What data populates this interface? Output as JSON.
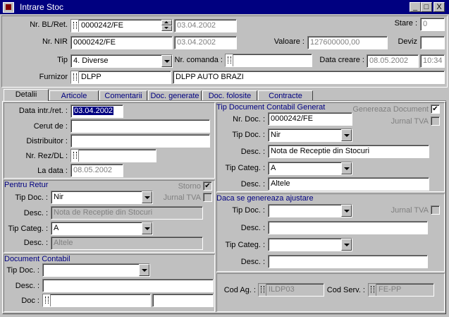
{
  "window": {
    "title": "Intrare Stoc",
    "buttons": {
      "minimize": "_",
      "maximize": "□",
      "close": "X"
    }
  },
  "header": {
    "nr_bl_label": "Nr. BL/Ret.",
    "nr_bl_value": "0000242/FE",
    "nr_bl_date": "03.04.2002",
    "nr_nir_label": "Nr. NIR",
    "nr_nir_value": "0000242/FE",
    "nr_nir_date": "03.04.2002",
    "tip_label": "Tip",
    "tip_value": "4. Diverse",
    "nr_comanda_label": "Nr. comanda :",
    "nr_comanda_value": "",
    "furnizor_label": "Furnizor",
    "furnizor_code": "DLPP",
    "furnizor_name": "DLPP AUTO BRAZI",
    "stare_label": "Stare :",
    "stare_value": "0",
    "valoare_label": "Valoare :",
    "valoare_value": "127600000,00",
    "deviz_label": "Deviz",
    "deviz_value": "",
    "data_creare_label": "Data creare :",
    "data_creare_value": "08.05.2002",
    "ora_creare_value": "10:34"
  },
  "tabs": [
    "Detalii",
    "Articole",
    "Comentarii",
    "Doc. generate",
    "Doc. folosite",
    "Contracte"
  ],
  "detalii": {
    "data_intr_label": "Data intr./ret. :",
    "data_intr_value": "03.04.2002",
    "cerut_de_label": "Cerut de :",
    "cerut_de_value": "",
    "distribuitor_label": "Distribuitor :",
    "distribuitor_value": "",
    "nr_rez_label": "Nr. Rez/DL :",
    "nr_rez_value": "",
    "la_data_label": "La data :",
    "la_data_value": "08.05.2002"
  },
  "pentru_retur": {
    "title": "Pentru Retur",
    "storno_label": "Storno",
    "storno_checked": true,
    "jurnal_tva_label": "Jurnal TVA",
    "tip_doc_label": "Tip Doc. :",
    "tip_doc_value": "Nir",
    "desc1_label": "Desc. :",
    "desc1_value": "Nota de Receptie din Stocuri",
    "tip_categ_label": "Tip Categ. :",
    "tip_categ_value": "A",
    "desc2_label": "Desc. :",
    "desc2_value": "Altele"
  },
  "document_contabil": {
    "title": "Document Contabil",
    "tip_doc_label": "Tip Doc. :",
    "tip_doc_value": "",
    "desc_label": "Desc. :",
    "desc_value": "",
    "doc_label": "Doc :",
    "doc_value": "",
    "doc_value2": ""
  },
  "tip_doc_generat": {
    "title": "Tip Document Contabil Generat",
    "genereaza_label": "Genereaza Document",
    "genereaza_checked": true,
    "jurnal_tva_label": "Jurnal TVA",
    "nr_doc_label": "Nr. Doc. :",
    "nr_doc_value": "0000242/FE",
    "tip_doc_label": "Tip Doc. :",
    "tip_doc_value": "Nir",
    "desc1_label": "Desc. :",
    "desc1_value": "Nota de Receptie din Stocuri",
    "tip_categ_label": "Tip Categ. :",
    "tip_categ_value": "A",
    "desc2_label": "Desc. :",
    "desc2_value": "Altele"
  },
  "ajustare": {
    "title": "Daca se genereaza ajustare",
    "tip_doc_label": "Tip Doc. :",
    "tip_doc_value": "",
    "jurnal_tva_label": "Jurnal TVA",
    "desc1_label": "Desc. :",
    "desc1_value": "",
    "tip_categ_label": "Tip Categ. :",
    "tip_categ_value": "",
    "desc2_label": "Desc. :",
    "desc2_value": ""
  },
  "footer": {
    "cod_ag_label": "Cod Ag. :",
    "cod_ag_value": "ILDP03",
    "cod_serv_label": "Cod Serv. :",
    "cod_serv_value": "FE-PP"
  }
}
